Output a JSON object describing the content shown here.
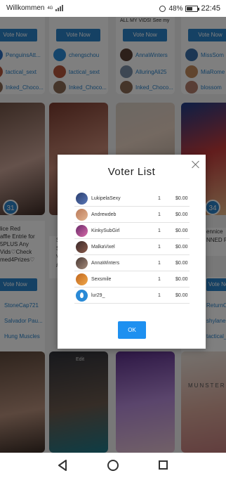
{
  "statusbar": {
    "carrier": "Willkommen",
    "network": "4G",
    "alarm_icon": "alarm-icon",
    "battery": "48%",
    "time": "22:45"
  },
  "background": {
    "columns": [
      {
        "vote_label": "Vote Now",
        "voters": [
          "PenguinsAtt...",
          "tactical_sext",
          "Inked_Choco..."
        ],
        "badge": "31",
        "card_text": [
          "lice Red",
          "affle Entrie for",
          "5PLUS Any",
          "Vids♡Check",
          "med4Prizes♡"
        ],
        "vote2": "Vote Now",
        "voters2": [
          "StoneCap721",
          "Salvador Pau...",
          "Hung Muscles"
        ]
      },
      {
        "vote_label": "Vote Now",
        "voters": [
          "chengschou",
          "tactical_sext",
          "Inked_Choco..."
        ],
        "card_text": [
          "S",
          "S",
          "V",
          "#"
        ],
        "edit": "Edit"
      },
      {
        "vote_label": "Vote Now",
        "top_text": "ALL MY VIDS! See my",
        "voters": [
          "AnnaWinters",
          "AlluringAli25",
          "Inked_Choco..."
        ]
      },
      {
        "vote_label": "Vote Now",
        "voters": [
          "MissSom",
          "MiaRome",
          "blossom"
        ],
        "badge": "34",
        "card_text": [
          "ennice",
          "NNED PO"
        ],
        "vote2": "Vote Now",
        "voters2": [
          "ReturnOf",
          "shylaner",
          "tactical_s"
        ],
        "photo_text": "MUNSTER"
      }
    ]
  },
  "modal": {
    "title": "Voter List",
    "close_icon": "close-icon",
    "rows": [
      {
        "name": "LukipelaSexy",
        "count": "1",
        "amount": "$0.00"
      },
      {
        "name": "Andrewdeb",
        "count": "1",
        "amount": "$0.00"
      },
      {
        "name": "KinkySubGirl",
        "count": "1",
        "amount": "$0.00"
      },
      {
        "name": "MalkaVixel",
        "count": "1",
        "amount": "$0.00"
      },
      {
        "name": "AnnaWinters",
        "count": "1",
        "amount": "$0.00"
      },
      {
        "name": "Sexsmile",
        "count": "1",
        "amount": "$0.00"
      },
      {
        "name": "lur29_",
        "count": "1",
        "amount": "$0.00"
      }
    ],
    "ok_label": "OK"
  },
  "navbar": {
    "back_icon": "back-triangle-icon",
    "home_icon": "home-circle-icon",
    "recent_icon": "recent-square-icon"
  },
  "colors": {
    "accent": "#2a82c8",
    "ok_button": "#1e90f0",
    "overlay": "rgba(0,0,0,0.5)"
  }
}
